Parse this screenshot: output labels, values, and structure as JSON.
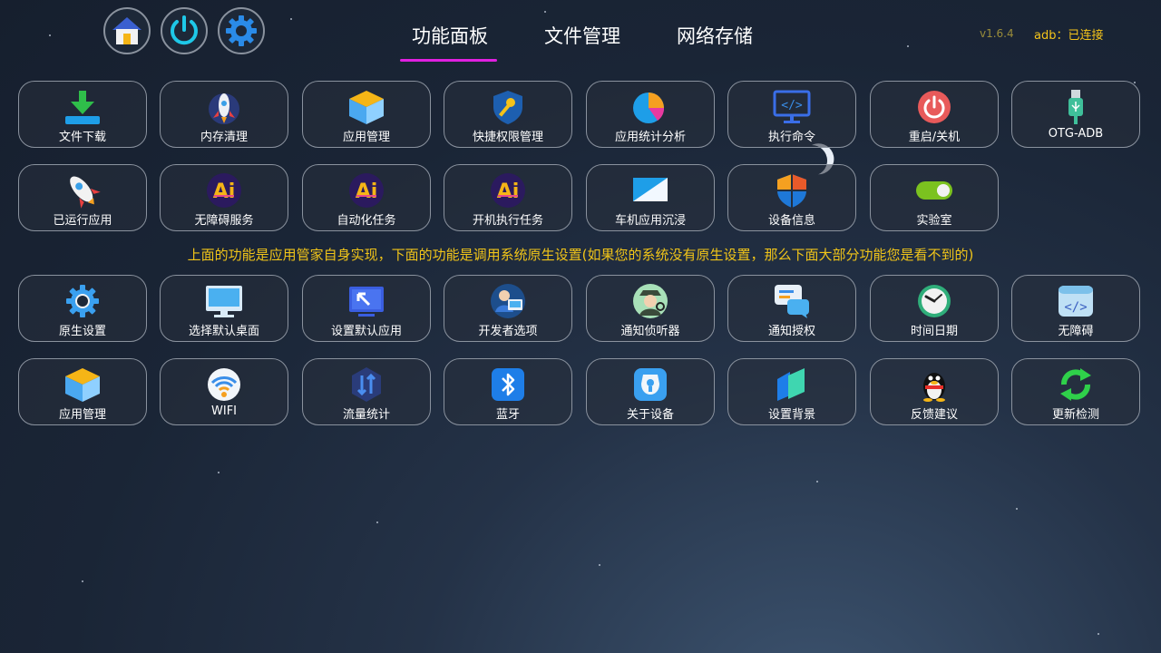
{
  "header": {
    "tabs": [
      {
        "label": "功能面板",
        "active": true
      },
      {
        "label": "文件管理",
        "active": false
      },
      {
        "label": "网络存储",
        "active": false
      }
    ],
    "version": "v1.6.4",
    "adb_status": "adb：已连接",
    "icons": [
      "home-icon",
      "power-icon",
      "settings-gear-icon"
    ],
    "accent_color": "#e020e0"
  },
  "notice": "上面的功能是应用管家自身实现，下面的功能是调用系统原生设置(如果您的系统没有原生设置，那么下面大部分功能您是看不到的)",
  "rows": [
    [
      {
        "label": "文件下载",
        "icon": "download-icon"
      },
      {
        "label": "内存清理",
        "icon": "rocket-clean-icon"
      },
      {
        "label": "应用管理",
        "icon": "cube-icon"
      },
      {
        "label": "快捷权限管理",
        "icon": "shield-key-icon"
      },
      {
        "label": "应用统计分析",
        "icon": "pie-chart-icon"
      },
      {
        "label": "执行命令",
        "icon": "code-monitor-icon"
      },
      {
        "label": "重启/关机",
        "icon": "power-icon"
      },
      {
        "label": "OTG-ADB",
        "icon": "usb-icon"
      }
    ],
    [
      {
        "label": "已运行应用",
        "icon": "rocket-icon"
      },
      {
        "label": "无障碍服务",
        "icon": "ai-icon"
      },
      {
        "label": "自动化任务",
        "icon": "ai-icon"
      },
      {
        "label": "开机执行任务",
        "icon": "ai-icon"
      },
      {
        "label": "车机应用沉浸",
        "icon": "screen-icon"
      },
      {
        "label": "设备信息",
        "icon": "windows-shield-icon"
      },
      {
        "label": "实验室",
        "icon": "toggle-icon"
      }
    ],
    [
      {
        "label": "原生设置",
        "icon": "gear-icon"
      },
      {
        "label": "选择默认桌面",
        "icon": "desktop-monitor-icon"
      },
      {
        "label": "设置默认应用",
        "icon": "arrow-monitor-icon"
      },
      {
        "label": "开发者选项",
        "icon": "developer-icon"
      },
      {
        "label": "通知侦听器",
        "icon": "detective-icon"
      },
      {
        "label": "通知授权",
        "icon": "chat-bubble-icon"
      },
      {
        "label": "时间日期",
        "icon": "clock-icon"
      },
      {
        "label": "无障碍",
        "icon": "code-window-icon"
      }
    ],
    [
      {
        "label": "应用管理",
        "icon": "cube-icon"
      },
      {
        "label": "WIFI",
        "icon": "wifi-icon"
      },
      {
        "label": "流量统计",
        "icon": "traffic-icon"
      },
      {
        "label": "蓝牙",
        "icon": "bluetooth-icon"
      },
      {
        "label": "关于设备",
        "icon": "about-device-icon"
      },
      {
        "label": "设置背景",
        "icon": "background-icon"
      },
      {
        "label": "反馈建议",
        "icon": "qq-penguin-icon"
      },
      {
        "label": "更新检测",
        "icon": "refresh-icon"
      }
    ]
  ]
}
